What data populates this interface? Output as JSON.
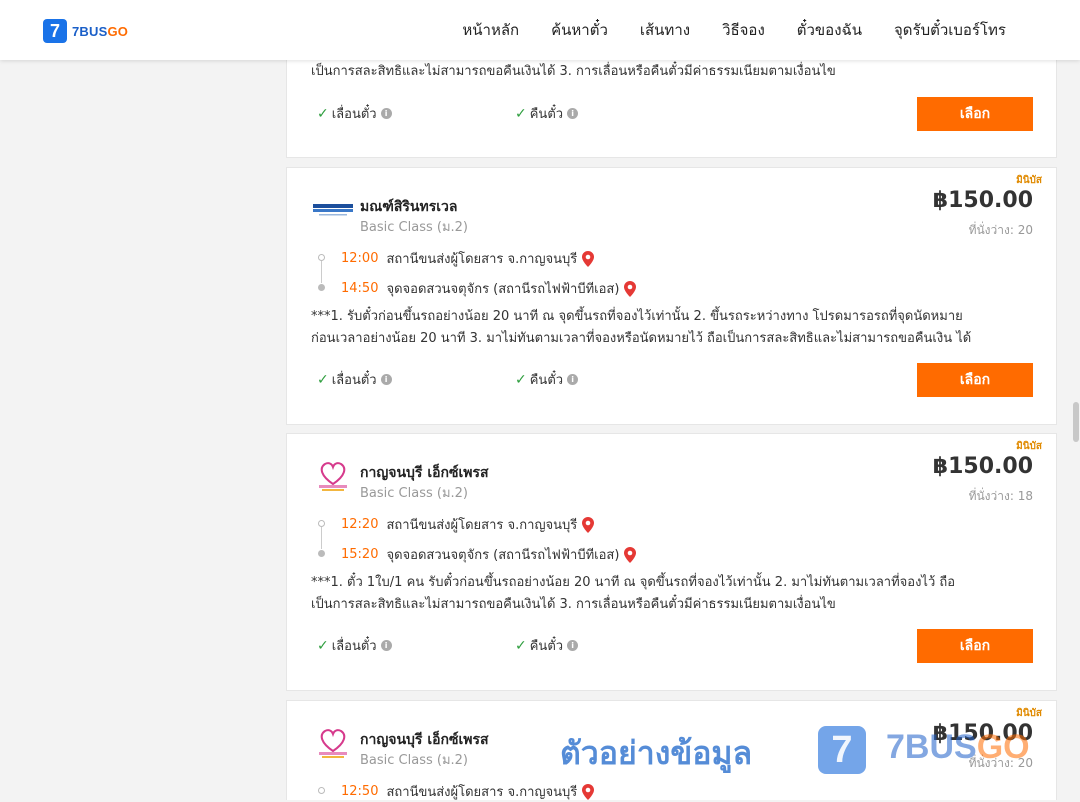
{
  "brand": {
    "mark": "7",
    "name_main": "7BUS",
    "name_go": "GO"
  },
  "nav": [
    {
      "label": "หน้าหลัก"
    },
    {
      "label": "ค้นหาตั๋ว"
    },
    {
      "label": "เส้นทาง"
    },
    {
      "label": "วิธีจอง"
    },
    {
      "label": "ตั๋วของฉัน"
    },
    {
      "label": "จุดรับตั๋วเบอร์โทร"
    }
  ],
  "colors": {
    "accent": "#ff6b00",
    "brand_blue": "#1a73e8",
    "check_green": "#2e9e3e",
    "ribbon": "#e08a00"
  },
  "features": {
    "reschedule": "เลื่อนตั๋ว",
    "refund": "คืนตั๋ว"
  },
  "select_label": "เลือก",
  "partial_card": {
    "desc_line2": "เป็นการสละสิทธิและไม่สามารถขอคืนเงินได้ 3. การเลื่อนหรือคืนตั๋วมีค่าธรรมเนียมตามเงื่อนไข"
  },
  "trips": [
    {
      "ribbon": "มินิบัส",
      "operator": "มณฑ์สิรินทรเวล",
      "class": "Basic Class (ม.2)",
      "price": "฿150.00",
      "seats": "ที่นั่งว่าง: 20",
      "logo_icon": "montsiri-logo-icon",
      "depart_time": "12:00",
      "depart_station": "สถานีขนส่งผู้โดยสาร จ.กาญจนบุรี",
      "arrive_time": "14:50",
      "arrive_station": "จุดจอดสวนจตุจักร (สถานีรถไฟฟ้าบีทีเอส)",
      "desc_line1": "***1. รับตั๋วก่อนขึ้นรถอย่างน้อย 20 นาที ณ จุดขึ้นรถที่จองไว้เท่านั้น 2. ขึ้นรถระหว่างทาง โปรดมารอรถที่จุดนัดหมาย",
      "desc_line2": "ก่อนเวลาอย่างน้อย 20 นาที 3. มาไม่ทันตามเวลาที่จองหรือนัดหมายไว้ ถือเป็นการสละสิทธิและไม่สามารถขอคืนเงิน ได้"
    },
    {
      "ribbon": "มินิบัส",
      "operator": "กาญจนบุรี เอ็กซ์เพรส",
      "class": "Basic Class (ม.2)",
      "price": "฿150.00",
      "seats": "ที่นั่งว่าง: 18",
      "logo_icon": "kanchanaburi-express-logo-icon",
      "depart_time": "12:20",
      "depart_station": "สถานีขนส่งผู้โดยสาร จ.กาญจนบุรี",
      "arrive_time": "15:20",
      "arrive_station": "จุดจอดสวนจตุจักร (สถานีรถไฟฟ้าบีทีเอส)",
      "desc_line1": "***1. ตั๋ว 1ใบ/1 คน รับตั๋วก่อนขึ้นรถอย่างน้อย 20 นาที ณ จุดขึ้นรถที่จองไว้เท่านั้น 2. มาไม่ทันตามเวลาที่จองไว้ ถือ",
      "desc_line2": "เป็นการสละสิทธิและไม่สามารถขอคืนเงินได้ 3. การเลื่อนหรือคืนตั๋วมีค่าธรรมเนียมตามเงื่อนไข"
    },
    {
      "ribbon": "มินิบัส",
      "operator": "กาญจนบุรี เอ็กซ์เพรส",
      "class": "Basic Class (ม.2)",
      "price": "฿150.00",
      "seats": "ที่นั่งว่าง: 20",
      "logo_icon": "kanchanaburi-express-logo-icon",
      "depart_time": "12:50",
      "depart_station": "สถานีขนส่งผู้โดยสาร จ.กาญจนบุรี"
    }
  ],
  "watermark": {
    "text": "ตัวอย่างข้อมูล",
    "mark": "7",
    "brand_main": "7BUS",
    "brand_go": "GO"
  }
}
